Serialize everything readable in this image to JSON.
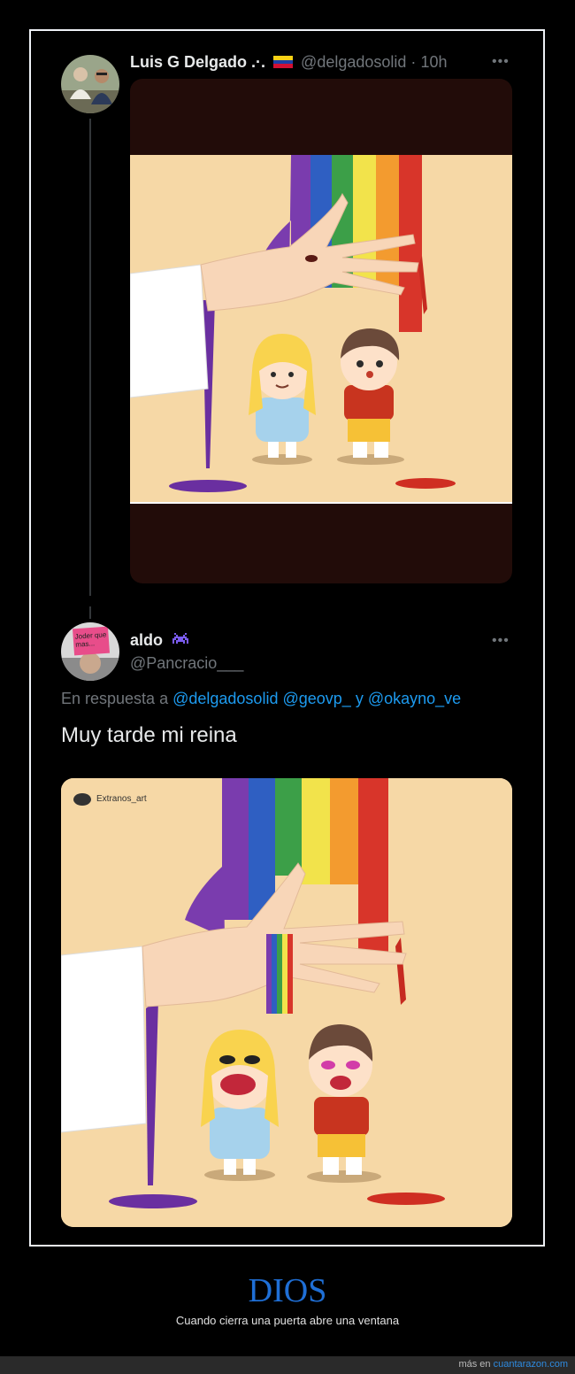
{
  "tweet1": {
    "display_name": "Luis G Delgado .·.",
    "flag_icon": "venezuela-flag-icon",
    "handle": "@delgadosolid",
    "separator": "·",
    "time": "10h",
    "more_icon": "more-icon"
  },
  "tweet2": {
    "display_name": "aldo",
    "emoji_icon": "space-invader-icon",
    "handle": "@Pancracio___",
    "avatar_sign_text": "Joder que mas...",
    "reply_prefix": "En respuesta a",
    "reply_mention_1": "@delgadosolid",
    "reply_mention_2": "@geovp_",
    "reply_connector": "y",
    "reply_mention_3": "@okayno_ve",
    "body": "Muy tarde mi reina",
    "watermark": "Extranos_art",
    "more_icon": "more-icon"
  },
  "caption": {
    "title": "DIOS",
    "subtitle": "Cuando cierra una puerta abre una ventana"
  },
  "footer": {
    "prefix": "más en",
    "site": "cuantarazon.com"
  },
  "colors": {
    "link": "#1d9bf0",
    "caption_title": "#1f6fd6",
    "panel_bg": "#000000",
    "illustration_bg": "#f6d8a6"
  }
}
